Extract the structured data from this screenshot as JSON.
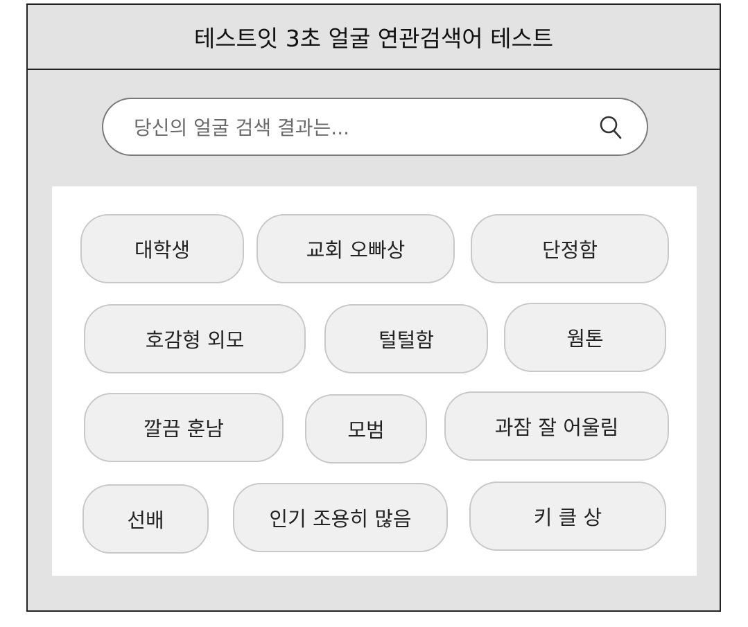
{
  "header": {
    "title": "테스트잇 3초 얼굴 연관검색어 테스트"
  },
  "search": {
    "placeholder": "당신의 얼굴 검색 결과는...",
    "value": "",
    "icon": "search-icon"
  },
  "tags": [
    "대학생",
    "교회 오빠상",
    "단정함",
    "호감형 외모",
    "털털함",
    "웜톤",
    "깔끔 훈남",
    "모범",
    "과잠 잘 어울림",
    "선배",
    "인기 조용히 많음",
    "키 클 상"
  ],
  "colors": {
    "frame_bg": "#e3e3e3",
    "panel_bg": "#ffffff",
    "tag_bg": "#f0f0f0",
    "tag_border": "#c8c8c8",
    "border": "#222222"
  }
}
